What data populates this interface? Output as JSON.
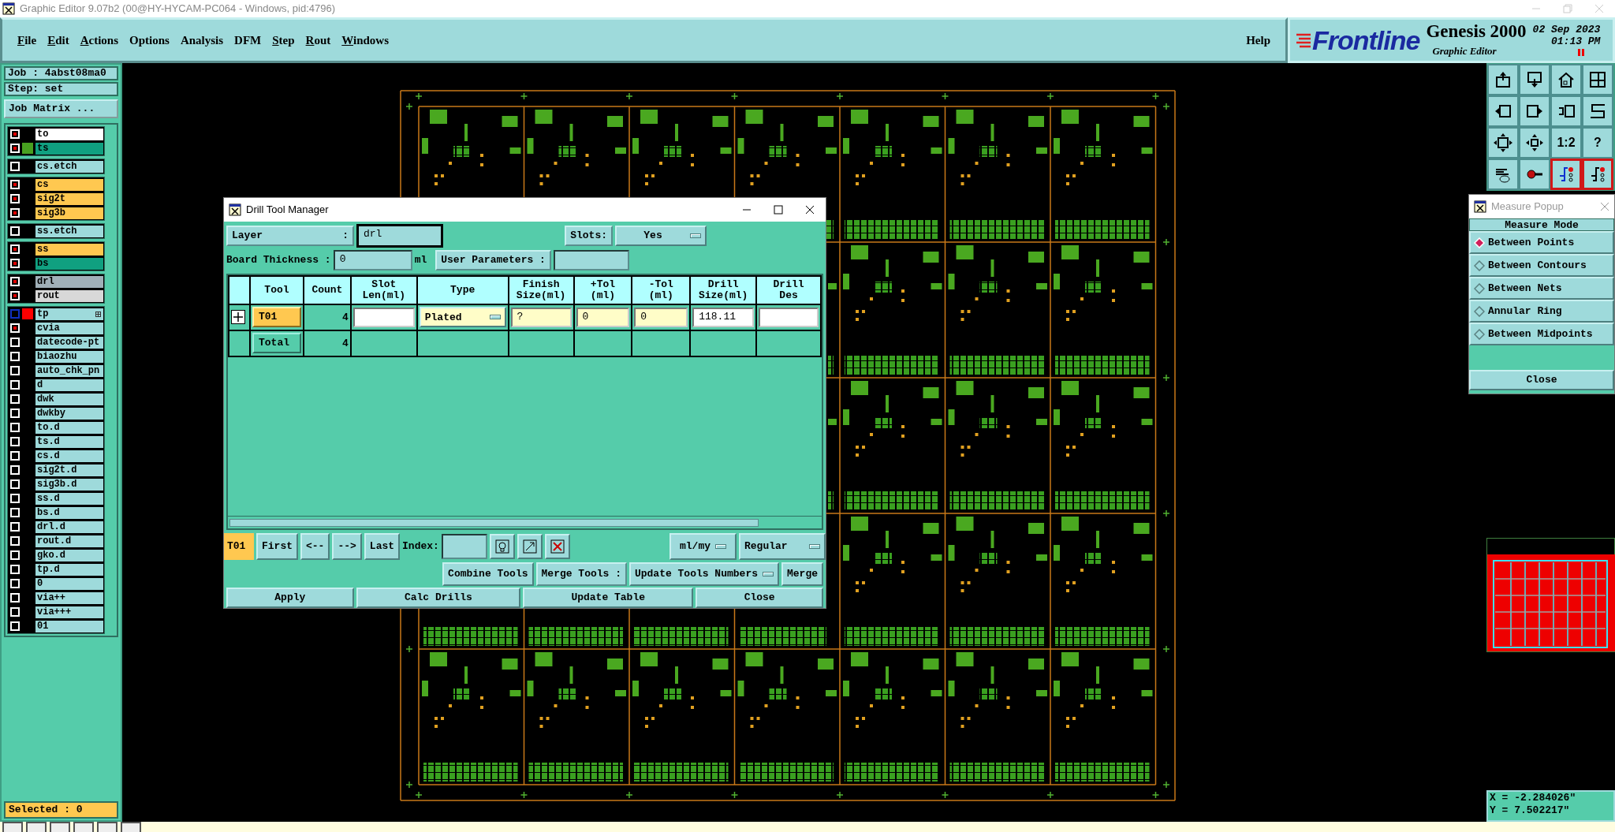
{
  "window": {
    "title": "Graphic Editor 9.07b2 (00@HY-HYCAM-PC064 - Windows, pid:4796)"
  },
  "menu": [
    {
      "label": "File",
      "mnemonic": true
    },
    {
      "label": "Edit",
      "mnemonic": true
    },
    {
      "label": "Actions",
      "mnemonic": true
    },
    {
      "label": "Options",
      "mnemonic": false
    },
    {
      "label": "Analysis",
      "mnemonic": false
    },
    {
      "label": "DFM",
      "mnemonic": false
    },
    {
      "label": "Step",
      "mnemonic": true
    },
    {
      "label": "Rout",
      "mnemonic": true
    },
    {
      "label": "Windows",
      "mnemonic": true
    }
  ],
  "help_menu": {
    "label": "Help"
  },
  "brand": {
    "logo": "Frontline",
    "product": "Genesis 2000",
    "subtitle": "Graphic Editor",
    "date": "02 Sep 2023",
    "time": "01:13 PM"
  },
  "job_panel": {
    "job": "Job : 4abst08ma0",
    "step": "Step: set",
    "matrix_button": "Job Matrix ...",
    "selected_count": "Selected : 0"
  },
  "layer_groups": [
    {
      "layers": [
        {
          "name": "to",
          "checked": true,
          "selected": false,
          "color": "#ffffff"
        },
        {
          "name": "ts",
          "checked": true,
          "selected": false,
          "color": "#10a080",
          "swatch": {
            "color": "#48a020"
          }
        }
      ]
    },
    {
      "layers": [
        {
          "name": "cs.etch",
          "checked": false,
          "selected": false,
          "color": "#9edadb"
        }
      ]
    },
    {
      "layers": [
        {
          "name": "cs",
          "checked": true,
          "selected": false,
          "color": "#ffc850"
        },
        {
          "name": "sig2t",
          "checked": true,
          "selected": false,
          "color": "#ffc850"
        },
        {
          "name": "sig3b",
          "checked": true,
          "selected": false,
          "color": "#ffc850"
        }
      ]
    },
    {
      "layers": [
        {
          "name": "ss.etch",
          "checked": false,
          "selected": false,
          "color": "#9edadb"
        }
      ]
    },
    {
      "layers": [
        {
          "name": "ss",
          "checked": true,
          "selected": false,
          "color": "#ffc850"
        },
        {
          "name": "bs",
          "checked": true,
          "selected": false,
          "color": "#10a080"
        }
      ]
    },
    {
      "layers": [
        {
          "name": "drl",
          "checked": true,
          "selected": false,
          "color": "#a0b0b8"
        },
        {
          "name": "rout",
          "checked": true,
          "selected": false,
          "color": "#d8d8d8"
        }
      ]
    },
    {
      "layers": [
        {
          "name": "tp",
          "checked": false,
          "selected": true,
          "color": "#9edadb",
          "swatch": {
            "color": "#ff0000"
          }
        },
        {
          "name": "cvia",
          "checked": true,
          "selected": false,
          "color": "#9edadb"
        },
        {
          "name": "datecode-pt",
          "checked": false,
          "selected": false,
          "color": "#9edadb"
        },
        {
          "name": "biaozhu",
          "checked": false,
          "selected": false,
          "color": "#9edadb"
        },
        {
          "name": "auto_chk_pn",
          "checked": false,
          "selected": false,
          "color": "#9edadb"
        },
        {
          "name": "d",
          "checked": false,
          "selected": false,
          "color": "#9edadb"
        },
        {
          "name": "dwk",
          "checked": false,
          "selected": false,
          "color": "#9edadb"
        },
        {
          "name": "dwkby",
          "checked": false,
          "selected": false,
          "color": "#9edadb"
        },
        {
          "name": "to.d",
          "checked": false,
          "selected": false,
          "color": "#9edadb"
        },
        {
          "name": "ts.d",
          "checked": false,
          "selected": false,
          "color": "#9edadb"
        },
        {
          "name": "cs.d",
          "checked": false,
          "selected": false,
          "color": "#9edadb"
        },
        {
          "name": "sig2t.d",
          "checked": false,
          "selected": false,
          "color": "#9edadb"
        },
        {
          "name": "sig3b.d",
          "checked": false,
          "selected": false,
          "color": "#9edadb"
        },
        {
          "name": "ss.d",
          "checked": false,
          "selected": false,
          "color": "#9edadb"
        },
        {
          "name": "bs.d",
          "checked": false,
          "selected": false,
          "color": "#9edadb"
        },
        {
          "name": "drl.d",
          "checked": false,
          "selected": false,
          "color": "#9edadb"
        },
        {
          "name": "rout.d",
          "checked": false,
          "selected": false,
          "color": "#9edadb"
        },
        {
          "name": "gko.d",
          "checked": false,
          "selected": false,
          "color": "#9edadb"
        },
        {
          "name": "tp.d",
          "checked": false,
          "selected": false,
          "color": "#9edadb"
        },
        {
          "name": "0",
          "checked": false,
          "selected": false,
          "color": "#9edadb"
        },
        {
          "name": "via++",
          "checked": false,
          "selected": false,
          "color": "#9edadb"
        },
        {
          "name": "via+++",
          "checked": false,
          "selected": false,
          "color": "#9edadb"
        },
        {
          "name": "01",
          "checked": false,
          "selected": false,
          "color": "#9edadb"
        }
      ]
    }
  ],
  "toolbar": [
    {
      "on": false
    },
    {
      "on": false
    },
    {
      "on": false
    },
    {
      "on": false
    },
    {
      "on": false
    },
    {
      "on": false
    },
    {
      "on": false
    },
    {
      "on": false
    },
    {
      "on": false
    },
    {
      "on": false
    },
    {
      "label": "1:2",
      "on": false
    },
    {
      "label": "?",
      "on": false
    },
    {
      "on": false
    },
    {
      "on": false
    },
    {
      "on": true
    },
    {
      "on": true
    }
  ],
  "drill_tool_manager": {
    "title": "Drill Tool Manager",
    "layer_label": "Layer",
    "layer_colon": ":",
    "layer_value": "drl",
    "slots_label": "Slots:",
    "slots_value": "Yes",
    "thickness_label": "Board Thickness :",
    "thickness_value": "0",
    "thickness_unit": "ml",
    "user_params_label": "User Parameters :",
    "columns": [
      "Tool",
      "Count",
      "Slot\nLen(ml)",
      "Type",
      "Finish\nSize(ml)",
      "+Tol\n(ml)",
      "-Tol\n(ml)",
      "Drill\nSize(ml)",
      "Drill\nDes"
    ],
    "rows": [
      {
        "kind": "tool",
        "tool": "T01",
        "count": "4",
        "type": "Plated",
        "finish": "?",
        "plus_tol": "0",
        "minus_tol": "0",
        "drill_size": "118.11"
      },
      {
        "kind": "total",
        "tool": "Total",
        "count": "4"
      }
    ],
    "current_tool": "T01",
    "nav_buttons": [
      "First",
      "<--",
      "-->",
      "Last"
    ],
    "index_label": "Index:",
    "units": "ml/my",
    "mode": "Regular",
    "combine_button": "Combine Tools",
    "merge_label": "Merge Tools :",
    "merge_option": "Update Tools Numbers",
    "merge_button": "Merge",
    "actions": [
      "Apply",
      "Calc Drills",
      "Update Table",
      "Close"
    ]
  },
  "measure_popup": {
    "title": "Measure Popup",
    "header": "Measure Mode",
    "options": [
      {
        "label": "Between Points",
        "selected": true
      },
      {
        "label": "Between Contours",
        "selected": false
      },
      {
        "label": "Between Nets",
        "selected": false
      },
      {
        "label": "Annular Ring",
        "selected": false
      },
      {
        "label": "Between Midpoints",
        "selected": false
      }
    ],
    "close": "Close"
  },
  "coordinates": {
    "x": "X = -2.284026\"",
    "y": "Y = 7.502217\""
  }
}
